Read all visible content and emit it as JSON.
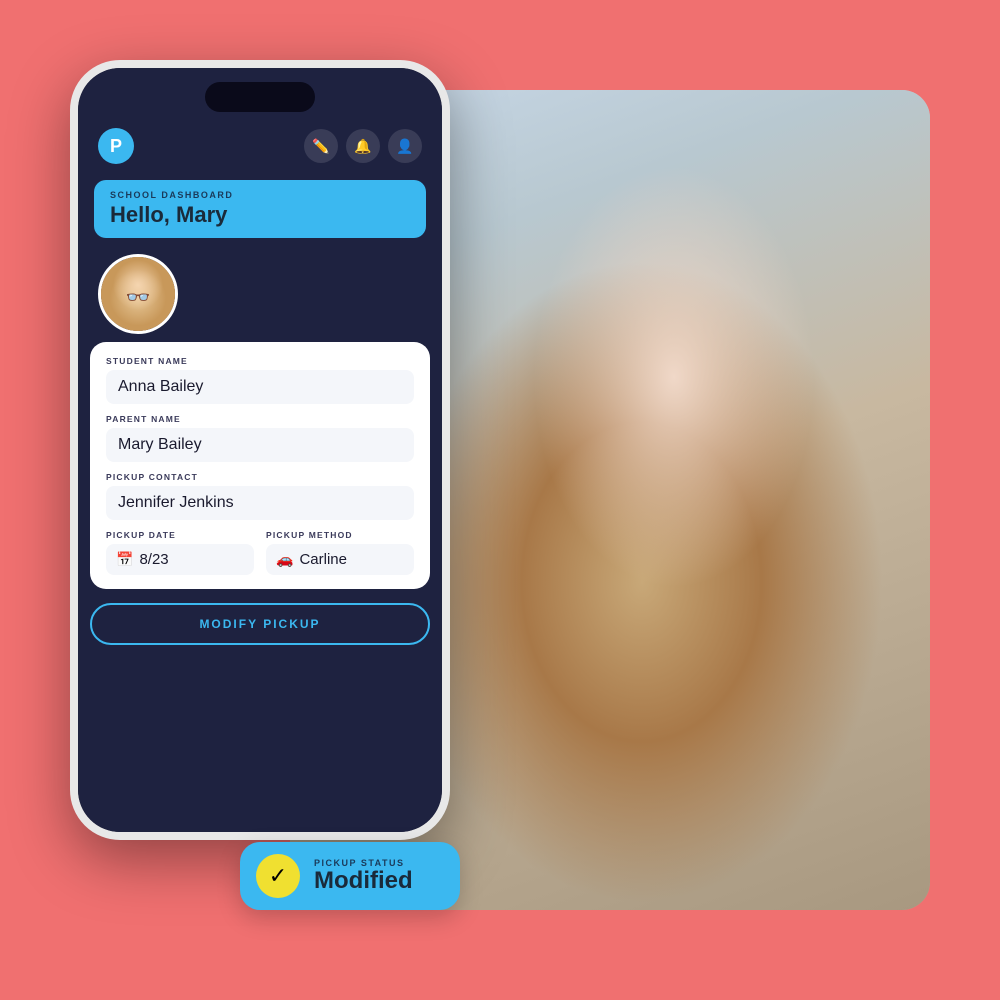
{
  "background": {
    "color": "#f07070"
  },
  "phone": {
    "top_bar": {
      "logo_letter": "P",
      "icons": [
        "✏️",
        "🔔",
        "👤"
      ]
    },
    "banner": {
      "subtitle": "School Dashboard",
      "greeting": "Hello, Mary"
    },
    "fields": {
      "student_label": "STUDENT NAME",
      "student_value": "Anna Bailey",
      "parent_label": "PARENT NAME",
      "parent_value": "Mary Bailey",
      "pickup_contact_label": "PICKUP CONTACT",
      "pickup_contact_value": "Jennifer Jenkins",
      "pickup_date_label": "PICKUP DATE",
      "pickup_date_value": "8/23",
      "pickup_method_label": "PICKUP METHOD",
      "pickup_method_value": "Carline"
    },
    "modify_button_label": "MODIFY PICKUP"
  },
  "status_badge": {
    "status_line1": "PICKUP STATUS",
    "status_line2": "Modified",
    "check_symbol": "✓"
  }
}
